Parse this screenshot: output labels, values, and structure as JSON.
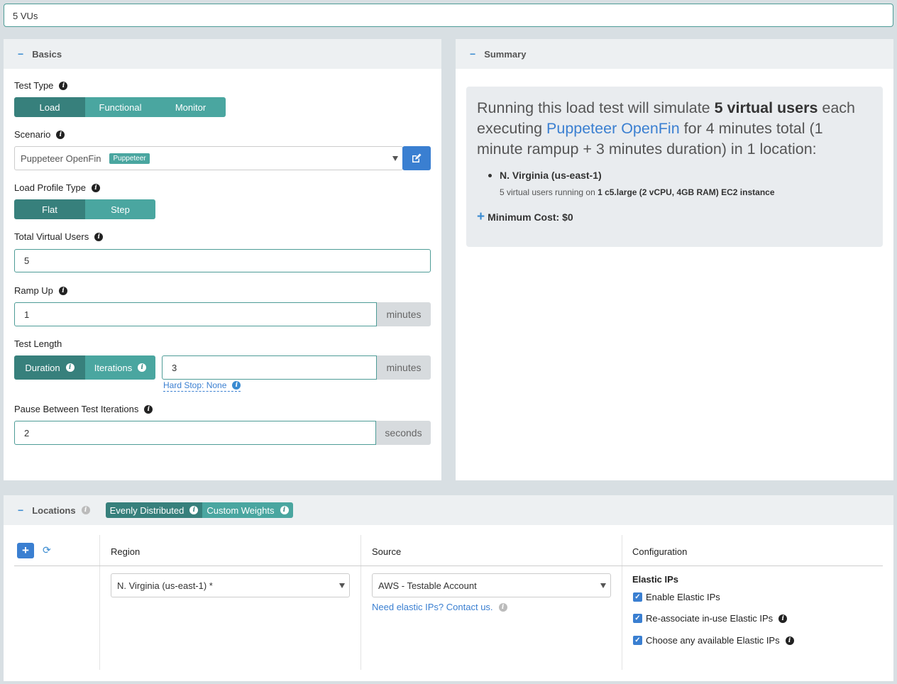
{
  "test_name": "5 VUs",
  "basics": {
    "title": "Basics",
    "test_type": {
      "label": "Test Type",
      "options": [
        "Load",
        "Functional",
        "Monitor"
      ],
      "selected": "Load"
    },
    "scenario": {
      "label": "Scenario",
      "value": "Puppeteer OpenFin",
      "badge": "Puppeteer"
    },
    "load_profile": {
      "label": "Load Profile Type",
      "options": [
        "Flat",
        "Step"
      ],
      "selected": "Flat"
    },
    "total_vus": {
      "label": "Total Virtual Users",
      "value": "5"
    },
    "ramp_up": {
      "label": "Ramp Up",
      "value": "1",
      "unit": "minutes"
    },
    "test_length": {
      "label": "Test Length",
      "options": [
        "Duration",
        "Iterations"
      ],
      "selected": "Duration",
      "value": "3",
      "unit": "minutes",
      "hard_stop": "Hard Stop: None"
    },
    "pause": {
      "label": "Pause Between Test Iterations",
      "value": "2",
      "unit": "seconds"
    }
  },
  "summary": {
    "title": "Summary",
    "text_1": "Running this load test will simulate ",
    "vus_bold": "5 virtual users",
    "text_2": " each executing ",
    "scenario_link": "Puppeteer OpenFin",
    "text_3": " for 4 minutes total (1 minute rampup + 3 minutes duration) in 1 location:",
    "location": "N. Virginia (us-east-1)",
    "detail_1": "5 virtual users running on ",
    "detail_bold": "1 c5.large (2 vCPU, 4GB RAM) EC2 instance",
    "min_cost": "Minimum Cost: $0"
  },
  "locations": {
    "title": "Locations",
    "distribution": [
      "Evenly Distributed",
      "Custom Weights"
    ],
    "selected": "Evenly Distributed",
    "columns": {
      "region": "Region",
      "source": "Source",
      "configuration": "Configuration"
    },
    "region_value": "N. Virginia (us-east-1) *",
    "source_value": "AWS - Testable Account",
    "contact_link": "Need elastic IPs? Contact us.",
    "config_title": "Elastic IPs",
    "checkboxes": [
      {
        "label": "Enable Elastic IPs",
        "checked": true
      },
      {
        "label": "Re-associate in-use Elastic IPs",
        "checked": true
      },
      {
        "label": "Choose any available Elastic IPs",
        "checked": true
      }
    ]
  }
}
